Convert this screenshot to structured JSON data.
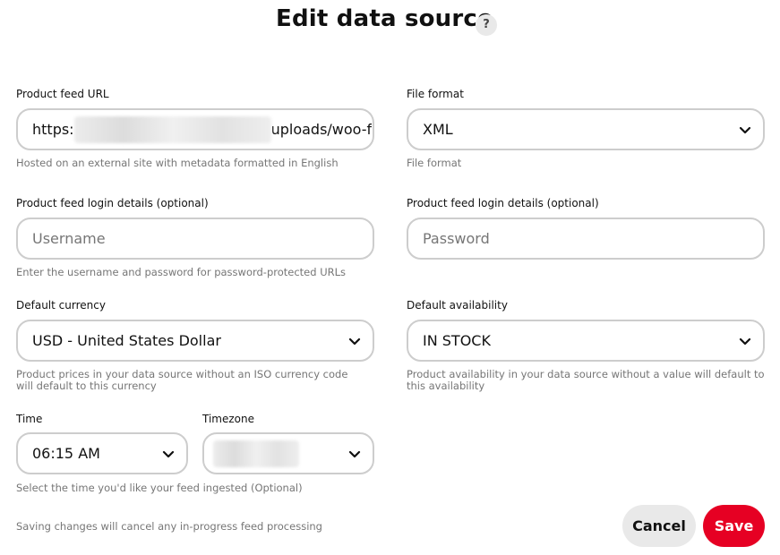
{
  "header": {
    "title": "Edit data source",
    "help_label": "?"
  },
  "product_feed_url": {
    "label": "Product feed URL",
    "value_prefix": "https:",
    "value_suffix": "uploads/woo-f",
    "hint": "Hosted on an external site with metadata formatted in English"
  },
  "file_format": {
    "label": "File format",
    "value": "XML",
    "hint": "File format"
  },
  "login_left": {
    "label": "Product feed login details (optional)",
    "placeholder": "Username",
    "hint": "Enter the username and password for password-protected URLs"
  },
  "login_right": {
    "label": "Product feed login details (optional)",
    "placeholder": "Password"
  },
  "default_currency": {
    "label": "Default currency",
    "value": "USD - United States Dollar",
    "hint": "Product prices in your data source without an ISO currency code will default to this currency"
  },
  "default_availability": {
    "label": "Default availability",
    "value": "IN STOCK",
    "hint": "Product availability in your data source without a value will default to this availability"
  },
  "time": {
    "label": "Time",
    "value": "06:15 AM",
    "hint": "Select the time you'd like your feed ingested (Optional)"
  },
  "timezone": {
    "label": "Timezone"
  },
  "footer": {
    "note": "Saving changes will cancel any in-progress feed processing",
    "cancel_label": "Cancel",
    "save_label": "Save"
  },
  "icons": {
    "help": "help-icon",
    "dropdown": "chevron-down-icon"
  },
  "colors": {
    "accent": "#e60023",
    "field_border": "#cdcdcd",
    "hint_text": "#767676"
  }
}
